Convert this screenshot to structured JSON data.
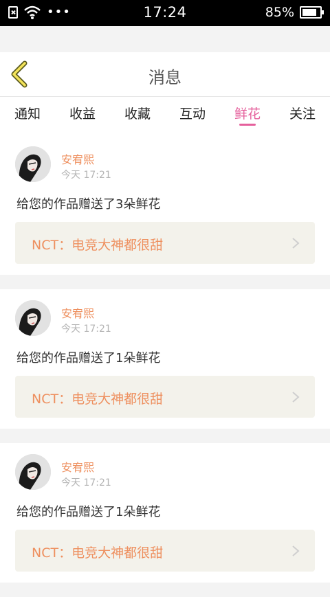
{
  "statusbar": {
    "time": "17:24",
    "battery_text": "85%",
    "battery_level": 0.85,
    "icons": [
      "sim-card-icon",
      "wifi-icon",
      "more-dots-icon",
      "battery-icon"
    ]
  },
  "header": {
    "title": "消息",
    "back_icon": "chevron-left-icon"
  },
  "tabs": [
    {
      "label": "通知",
      "active": false
    },
    {
      "label": "收益",
      "active": false
    },
    {
      "label": "收藏",
      "active": false
    },
    {
      "label": "互动",
      "active": false
    },
    {
      "label": "鲜花",
      "active": true
    },
    {
      "label": "关注",
      "active": false
    }
  ],
  "colors": {
    "accent_pink": "#e5609c",
    "name_orange": "#ee8f5e",
    "link_bg": "#f3f2eb"
  },
  "messages": [
    {
      "user": "安宥熙",
      "time": "今天 17:21",
      "text": "给您的作品赠送了3朵鲜花",
      "work": "NCT：电竞大神都很甜"
    },
    {
      "user": "安宥熙",
      "time": "今天 17:21",
      "text": "给您的作品赠送了1朵鲜花",
      "work": "NCT：电竞大神都很甜"
    },
    {
      "user": "安宥熙",
      "time": "今天 17:21",
      "text": "给您的作品赠送了1朵鲜花",
      "work": "NCT：电竞大神都很甜"
    }
  ]
}
